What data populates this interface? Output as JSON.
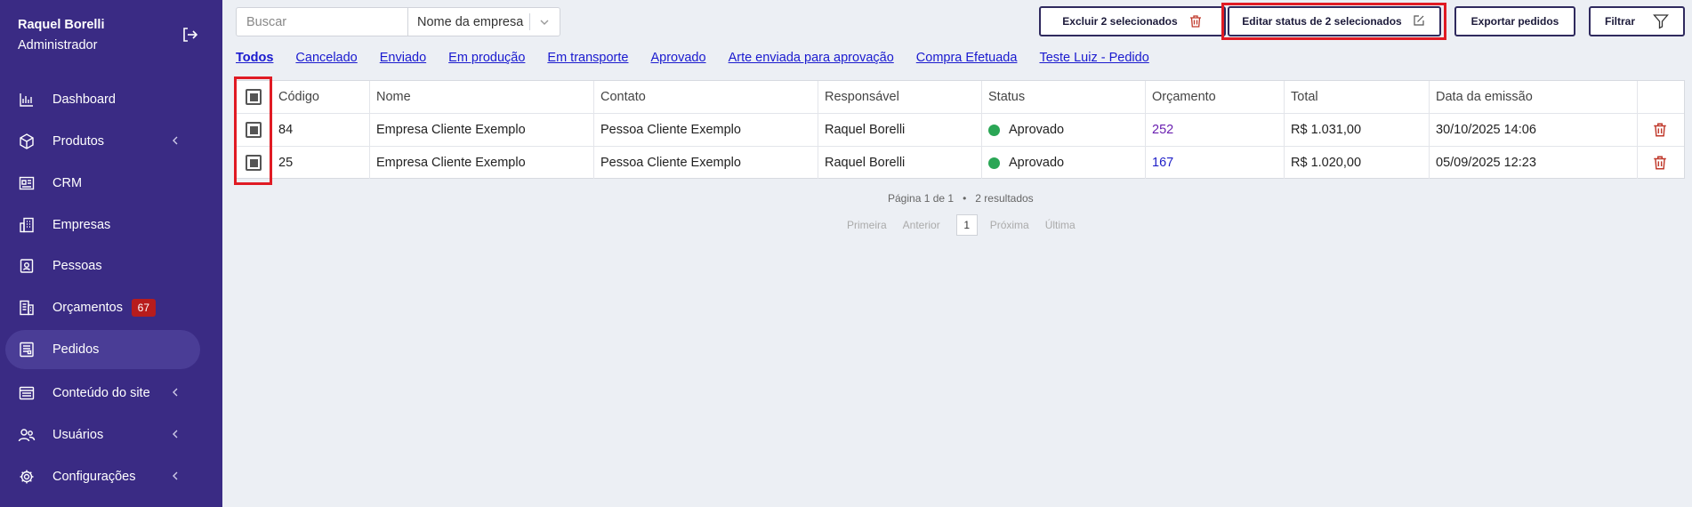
{
  "user": {
    "name": "Raquel Borelli",
    "role": "Administrador"
  },
  "nav": [
    {
      "label": "Dashboard",
      "icon": "chart-icon"
    },
    {
      "label": "Produtos",
      "icon": "box-icon",
      "chevron": true
    },
    {
      "label": "CRM",
      "icon": "crm-icon"
    },
    {
      "label": "Empresas",
      "icon": "building-icon"
    },
    {
      "label": "Pessoas",
      "icon": "person-card-icon"
    },
    {
      "label": "Orçamentos",
      "icon": "quote-icon",
      "badge": "67"
    },
    {
      "label": "Pedidos",
      "icon": "orders-icon",
      "active": true
    },
    {
      "label": "Conteúdo do site",
      "icon": "site-content-icon",
      "chevron": true
    },
    {
      "label": "Usuários",
      "icon": "users-icon",
      "chevron": true
    },
    {
      "label": "Configurações",
      "icon": "gear-icon",
      "chevron": true
    }
  ],
  "search": {
    "placeholder": "Buscar",
    "value": "",
    "field": "Nome da empresa"
  },
  "toolbar": {
    "delete_label": "Excluir 2 selecionados",
    "edit_status_label": "Editar status de 2 selecionados",
    "export_label": "Exportar pedidos",
    "filter_label": "Filtrar"
  },
  "tabs": [
    "Todos",
    "Cancelado",
    "Enviado",
    "Em produção",
    "Em transporte",
    "Aprovado",
    "Arte enviada para aprovação",
    "Compra Efetuada",
    "Teste Luiz - Pedido"
  ],
  "table": {
    "headers": [
      "Código",
      "Nome",
      "Contato",
      "Responsável",
      "Status",
      "Orçamento",
      "Total",
      "Data da emissão"
    ],
    "rows": [
      {
        "codigo": "84",
        "nome": "Empresa Cliente Exemplo",
        "contato": "Pessoa Cliente Exemplo",
        "responsavel": "Raquel Borelli",
        "status": "Aprovado",
        "orcamento": "252",
        "total": "R$ 1.031,00",
        "data": "30/10/2025 14:06"
      },
      {
        "codigo": "25",
        "nome": "Empresa Cliente Exemplo",
        "contato": "Pessoa Cliente Exemplo",
        "responsavel": "Raquel Borelli",
        "status": "Aprovado",
        "orcamento": "167",
        "total": "R$ 1.020,00",
        "data": "05/09/2025 12:23"
      }
    ]
  },
  "pagination": {
    "info": "Página 1 de 1",
    "separator": "•",
    "results": "2 resultados",
    "first": "Primeira",
    "prev": "Anterior",
    "current": "1",
    "next": "Próxima",
    "last": "Última"
  },
  "colors": {
    "sidebar": "#3a2b84",
    "accent": "#2f2a5e",
    "highlight": "#e01b24",
    "status_approved": "#2aa655",
    "badge": "#b81c1c"
  }
}
